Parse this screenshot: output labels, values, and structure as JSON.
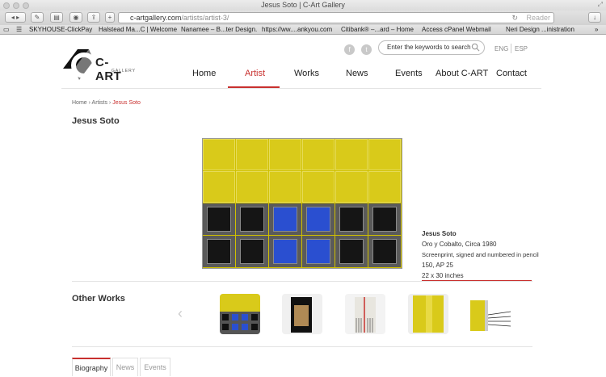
{
  "browser": {
    "window_title": "Jesus Soto | C-Art Gallery",
    "url_host": "c-artgallery.com",
    "url_path": "/artists/artist-3/",
    "reader_label": "Reader",
    "bookmarks": [
      "SKYHOUSE-ClickPay",
      "Halstead Ma...C | Welcome",
      "Nanamee – B...ter Design.",
      "https://ww....ankyou.com",
      "Citibank® –...ard – Home",
      "Access cPanel Webmail",
      "Neri Design ...inistration"
    ]
  },
  "header": {
    "logo_text": "C-ART",
    "logo_sub": "GALLERY",
    "search_placeholder": "Enter the keywords to search",
    "lang_en": "ENG",
    "lang_es": "ESP",
    "social": [
      "f",
      "t"
    ]
  },
  "nav": {
    "items": [
      "Home",
      "Artist",
      "Works",
      "News",
      "Events",
      "About C-ART",
      "Contact"
    ],
    "active": "Artist"
  },
  "breadcrumb": {
    "home": "Home",
    "sep1": " › ",
    "artists": "Artists",
    "sep2": " › ",
    "current": "Jesus Soto"
  },
  "artist": {
    "name": "Jesus Soto"
  },
  "artwork": {
    "artist": "Jesus Soto",
    "title": "Oro y Cobalto, Circa 1980",
    "medium": "Screenprint, signed and numbered in pencil",
    "edition": "150, AP 25",
    "size": "22 x 30 inches",
    "colors": {
      "yellow": "#d9ca1a",
      "blue": "#2a4fd0",
      "black": "#151515",
      "gray": "#5a5a5a"
    }
  },
  "other_works": {
    "title": "Other Works",
    "prev_icon": "chevron-left-icon"
  },
  "tabs": [
    "Biography",
    "News",
    "Events"
  ],
  "accent_color": "#c8302e"
}
